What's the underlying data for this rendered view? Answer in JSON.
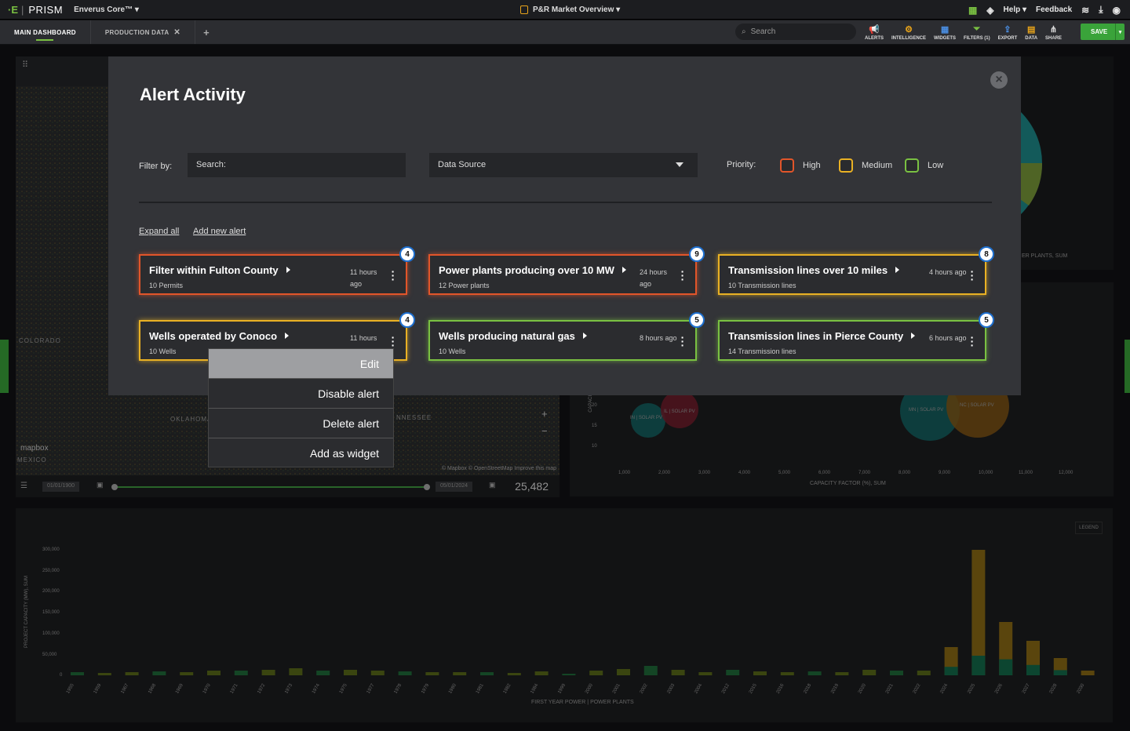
{
  "app": {
    "brand": "PRISM",
    "product": "Enverus Core™ ▾",
    "dashboard_title": "P&R Market Overview ▾",
    "help": "Help ▾",
    "feedback": "Feedback"
  },
  "tabs": [
    {
      "label": "MAIN DASHBOARD"
    },
    {
      "label": "PRODUCTION DATA"
    }
  ],
  "search": {
    "placeholder": "Search"
  },
  "tools": [
    {
      "label": "ALERTS",
      "icon": "megaphone-icon"
    },
    {
      "label": "INTELLIGENCE",
      "icon": "intelligence-icon"
    },
    {
      "label": "WIDGETS",
      "icon": "widgets-icon"
    },
    {
      "label": "FILTERS (1)",
      "icon": "filter-icon"
    },
    {
      "label": "EXPORT",
      "icon": "export-icon"
    },
    {
      "label": "DATA",
      "icon": "table-icon"
    },
    {
      "label": "SHARE",
      "icon": "share-icon"
    }
  ],
  "save_label": "SAVE",
  "map": {
    "labels": [
      "COLORADO",
      "OKLAHOMA",
      "NNESSEE",
      "MEXICO"
    ],
    "attribution": "© Mapbox © OpenStreetMap Improve this map",
    "mapbox": "mapbox",
    "start_date": "01/01/1900",
    "end_date": "05/01/2024",
    "count": "25,482"
  },
  "right_chart": {
    "x_title": "CAPACITY FACTOR (%), SUM",
    "y_title": "CAPACITY",
    "x_ticks": [
      "1,000",
      "2,000",
      "3,000",
      "4,000",
      "5,000",
      "6,000",
      "7,000",
      "8,000",
      "9,000",
      "10,000",
      "11,000",
      "12,000"
    ],
    "y_ticks": [
      "20",
      "15",
      "10"
    ],
    "bubble_labels": [
      "IN | SOLAR PV",
      "IL | SOLAR PV",
      "MN | SOLAR PV",
      "NC | SOLAR PV"
    ],
    "top_label": "ER PLANTS, SUM"
  },
  "bottom_chart": {
    "legend": "LEGEND",
    "y_title": "PROJECT CAPACITY (MW), SUM",
    "x_title": "FIRST YEAR POWER | POWER PLANTS",
    "y_ticks": [
      "300,000",
      "250,000",
      "200,000",
      "150,000",
      "100,000",
      "50,000",
      "0"
    ],
    "x_ticks": [
      "1955",
      "1959",
      "1967",
      "1968",
      "1969",
      "1970",
      "1971",
      "1972",
      "1973",
      "1974",
      "1975",
      "1977",
      "1978",
      "1979",
      "1980",
      "1981",
      "1982",
      "1984",
      "1999",
      "2000",
      "2001",
      "2002",
      "2003",
      "2004",
      "2012",
      "2015",
      "2016",
      "2018",
      "2019",
      "2020",
      "2021",
      "2022",
      "2024",
      "2025",
      "2026",
      "2027",
      "2028",
      "2030"
    ]
  },
  "modal": {
    "title": "Alert Activity",
    "filter_label": "Filter by:",
    "search_label": "Search:",
    "data_source_label": "Data Source",
    "priority_label": "Priority:",
    "priorities": [
      {
        "label": "High",
        "color": "#e2552a"
      },
      {
        "label": "Medium",
        "color": "#e9b124"
      },
      {
        "label": "Low",
        "color": "#7ac142"
      }
    ],
    "expand_all": "Expand all",
    "add_new_alert": "Add new alert",
    "alerts": [
      {
        "title": "Filter within Fulton County",
        "sub": "10 Permits",
        "time": "11 hours ago",
        "badge": "4",
        "priority": "high"
      },
      {
        "title": "Power plants producing over 10 MW",
        "sub": "12 Power plants",
        "time": "24 hours ago",
        "badge": "9",
        "priority": "high"
      },
      {
        "title": "Transmission lines over 10 miles",
        "sub": "10 Transmission lines",
        "time": "4 hours ago",
        "badge": "8",
        "priority": "med"
      },
      {
        "title": "Wells operated by Conoco",
        "sub": "10 Wells",
        "time": "11 hours ago",
        "badge": "4",
        "priority": "med"
      },
      {
        "title": "Wells producing natural gas",
        "sub": "10 Wells",
        "time": "8 hours ago",
        "badge": "5",
        "priority": "low"
      },
      {
        "title": "Transmission lines in Pierce County",
        "sub": "14 Transmission lines",
        "time": "6 hours ago",
        "badge": "5",
        "priority": "low"
      }
    ],
    "context_menu": [
      "Edit",
      "Disable alert",
      "Delete alert",
      "Add as widget"
    ]
  }
}
